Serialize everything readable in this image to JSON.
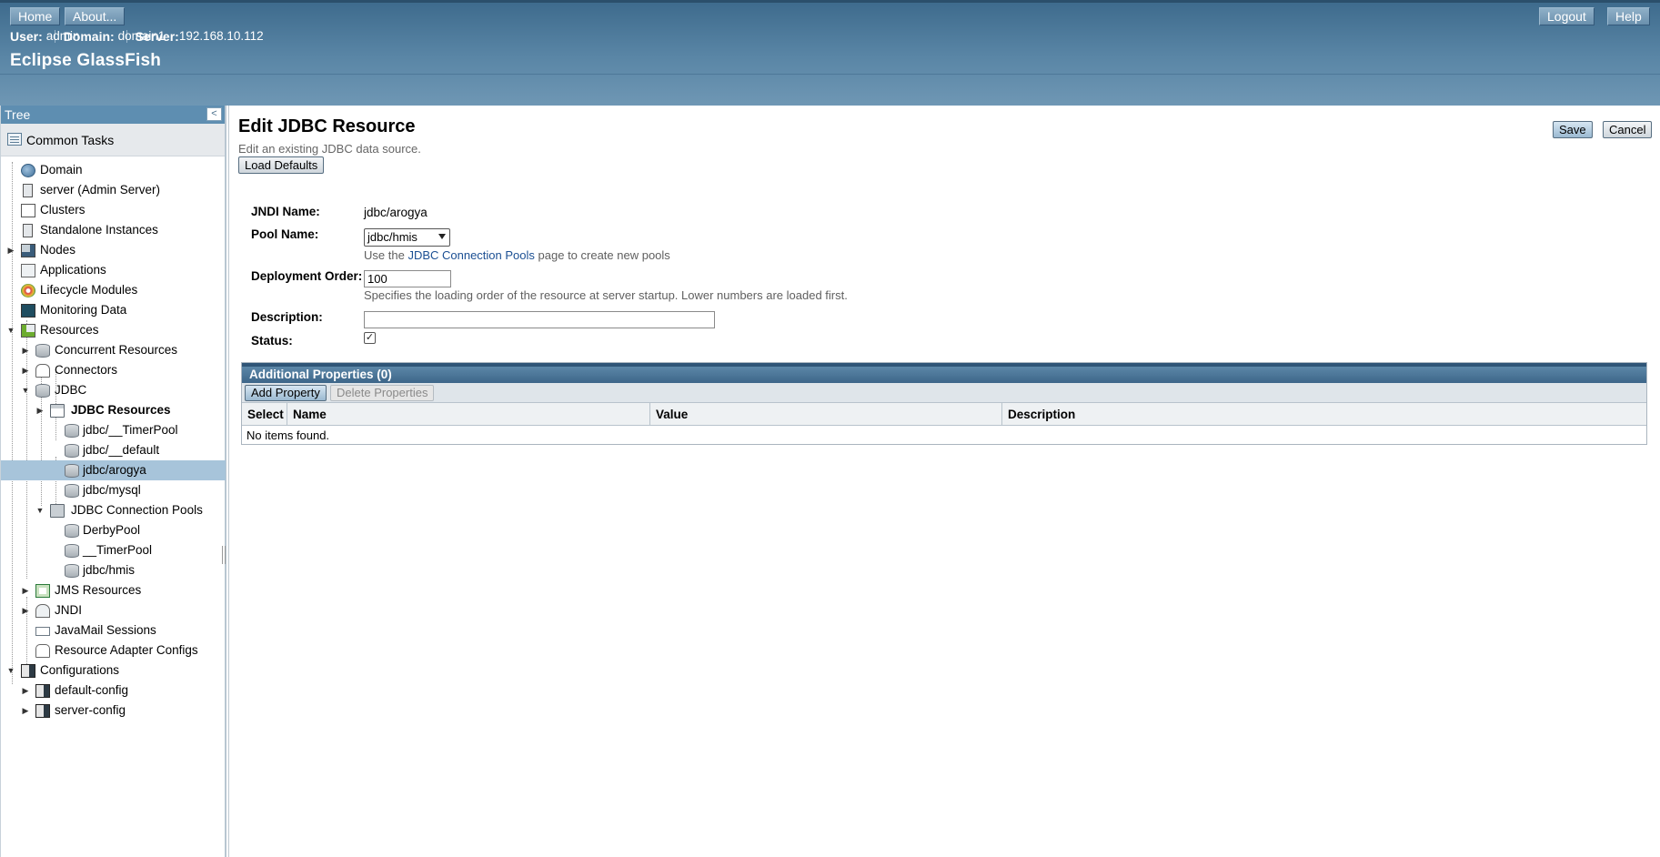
{
  "masthead": {
    "home_label": "Home",
    "about_label": "About...",
    "logout_label": "Logout",
    "help_label": "Help",
    "user_label": "User:",
    "user_value": "admin",
    "domain_label": "Domain:",
    "domain_value": "domain1",
    "server_label": "Server:",
    "server_value": "192.168.10.112",
    "brand": "Eclipse GlassFish"
  },
  "tree": {
    "header": "Tree",
    "collapse_glyph": "<",
    "common_tasks": "Common Tasks",
    "nodes": [
      {
        "label": "Domain",
        "icon": "globe-icon"
      },
      {
        "label": "server (Admin Server)",
        "icon": "server-icon"
      },
      {
        "label": "Clusters",
        "icon": "cluster-icon"
      },
      {
        "label": "Standalone Instances",
        "icon": "server-icon"
      },
      {
        "label": "Nodes",
        "icon": "node-icon"
      },
      {
        "label": "Applications",
        "icon": "application-icon"
      },
      {
        "label": "Lifecycle Modules",
        "icon": "gear-icon"
      },
      {
        "label": "Monitoring Data",
        "icon": "monitor-icon"
      },
      {
        "label": "Resources",
        "icon": "resources-icon"
      },
      {
        "label": "Concurrent Resources",
        "icon": "database-icon"
      },
      {
        "label": "Connectors",
        "icon": "connector-icon"
      },
      {
        "label": "JDBC",
        "icon": "database-icon"
      },
      {
        "label": "JDBC Resources",
        "icon": "folder-icon"
      },
      {
        "label": "jdbc/__TimerPool",
        "icon": "database-icon"
      },
      {
        "label": "jdbc/__default",
        "icon": "database-icon"
      },
      {
        "label": "jdbc/arogya",
        "icon": "database-icon"
      },
      {
        "label": "jdbc/mysql",
        "icon": "database-icon"
      },
      {
        "label": "JDBC Connection Pools",
        "icon": "folder-icon"
      },
      {
        "label": "DerbyPool",
        "icon": "database-icon"
      },
      {
        "label": "__TimerPool",
        "icon": "database-icon"
      },
      {
        "label": "jdbc/hmis",
        "icon": "database-icon"
      },
      {
        "label": "JMS Resources",
        "icon": "jms-icon"
      },
      {
        "label": "JNDI",
        "icon": "jndi-icon"
      },
      {
        "label": "JavaMail Sessions",
        "icon": "mail-icon"
      },
      {
        "label": "Resource Adapter Configs",
        "icon": "adapter-icon"
      },
      {
        "label": "Configurations",
        "icon": "config-icon"
      },
      {
        "label": "default-config",
        "icon": "config-icon"
      },
      {
        "label": "server-config",
        "icon": "config-icon"
      }
    ],
    "selected": "jdbc/arogya"
  },
  "page": {
    "title": "Edit JDBC Resource",
    "help": "Edit an existing JDBC data source.",
    "load_defaults_label": "Load Defaults",
    "save_label": "Save",
    "cancel_label": "Cancel"
  },
  "form": {
    "jndi_name_label": "JNDI Name:",
    "jndi_name_value": "jdbc/arogya",
    "pool_name_label": "Pool Name:",
    "pool_name_value": "jdbc/hmis",
    "pool_hint_prefix": "Use the",
    "pool_hint_link": "JDBC Connection Pools",
    "pool_hint_suffix": "page to create new pools",
    "deployment_order_label": "Deployment Order:",
    "deployment_order_value": "100",
    "deployment_order_hint": "Specifies the loading order of the resource at server startup. Lower numbers are loaded first.",
    "description_label": "Description:",
    "description_value": "",
    "status_label": "Status:",
    "status_checked": true
  },
  "properties": {
    "title": "Additional Properties (0)",
    "add_label": "Add Property",
    "delete_label": "Delete Properties",
    "columns": [
      "Select",
      "Name",
      "Value",
      "Description"
    ],
    "empty_text": "No items found."
  }
}
